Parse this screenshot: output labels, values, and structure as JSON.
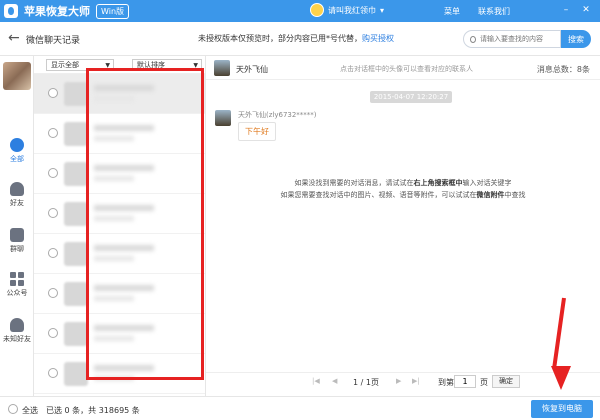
{
  "app": {
    "title": "苹果恢复大师",
    "edition_badge": "Win版",
    "username": "请叫我红领巾",
    "menu_label": "菜单",
    "contact_label": "联系我们"
  },
  "toolbar": {
    "page_title": "微信聊天记录",
    "notice_text": "未授权版本仅预览时，部分内容已用*号代替，",
    "notice_link": "购买授权",
    "search_placeholder": "请输入要查找的内容",
    "search_button": "搜索"
  },
  "nav": {
    "items": [
      {
        "label": "全部",
        "icon": "chat-bubble-icon",
        "active": true
      },
      {
        "label": "好友",
        "icon": "person-icon",
        "active": false
      },
      {
        "label": "群聊",
        "icon": "group-icon",
        "active": false
      },
      {
        "label": "公众号",
        "icon": "grid-icon",
        "active": false
      },
      {
        "label": "未知好友",
        "icon": "unknown-person-icon",
        "active": false
      }
    ]
  },
  "list": {
    "filter_value": "显示全部",
    "sort_value": "默认排序"
  },
  "chat": {
    "contact_name": "天外飞仙",
    "header_tip": "点击对话框中的头像可以查看对应的联系人",
    "message_count": "消息总数：8条",
    "timestamp": "2015-04-07 12:20:27",
    "sender": "天外飞仙(zly6732*****)",
    "message": "下午好",
    "hint_line1_pre": "如果没找到需要的对话消息，请试试在",
    "hint_line1_bold": "右上角搜索框中",
    "hint_line1_post": "输入对话关键字",
    "hint_line2_pre": "如果您需要查找对话中的图片、视频、语音等附件，可以试试在",
    "hint_line2_bold": "微信附件",
    "hint_line2_post": "中查找"
  },
  "pager": {
    "page_info": "1 / 1页",
    "goto_label": "到第",
    "page_value": "1",
    "page_unit": "页",
    "confirm": "确定"
  },
  "footer": {
    "select_all": "全选",
    "selection_info": "已选 0 条，共 318695 条",
    "recover_button": "恢复到电脑"
  },
  "colors": {
    "brand": "#3b97ea",
    "annotation_red": "#e62222",
    "accent_orange": "#e07a1e"
  }
}
